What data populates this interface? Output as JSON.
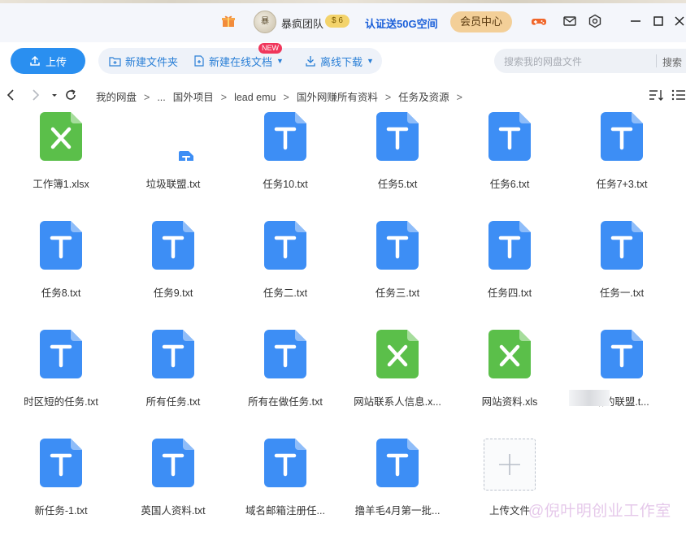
{
  "header": {
    "username": "暴疯团队",
    "coin_badge": "$ 6",
    "promo": "认证送50G空间",
    "vip_button": "会员中心",
    "icons": [
      "gift-icon",
      "game-icon",
      "mail-icon",
      "settings-icon",
      "minimize-icon",
      "maximize-icon",
      "close-icon"
    ]
  },
  "toolbar": {
    "upload": "上传",
    "new_folder": "新建文件夹",
    "new_online_doc": "新建在线文档",
    "new_badge": "NEW",
    "offline_download": "离线下载",
    "search_placeholder": "搜索我的网盘文件",
    "search_button": "搜索"
  },
  "breadcrumb": {
    "items": [
      "我的网盘",
      "...",
      "国外项目",
      "lead emu",
      "国外网赚所有资料",
      "任务及资源"
    ]
  },
  "files": [
    {
      "name": "工作簿1.xlsx",
      "type": "excel"
    },
    {
      "name": "垃圾联盟.txt",
      "type": "txt-small"
    },
    {
      "name": "任务10.txt",
      "type": "txt"
    },
    {
      "name": "任务5.txt",
      "type": "txt"
    },
    {
      "name": "任务6.txt",
      "type": "txt"
    },
    {
      "name": "任务7+3.txt",
      "type": "txt"
    },
    {
      "name": "任务8.txt",
      "type": "txt"
    },
    {
      "name": "任务9.txt",
      "type": "txt"
    },
    {
      "name": "任务二.txt",
      "type": "txt"
    },
    {
      "name": "任务三.txt",
      "type": "txt"
    },
    {
      "name": "任务四.txt",
      "type": "txt"
    },
    {
      "name": "任务一.txt",
      "type": "txt"
    },
    {
      "name": "时区短的任务.txt",
      "type": "txt"
    },
    {
      "name": "所有任务.txt",
      "type": "txt"
    },
    {
      "name": "所有在做任务.txt",
      "type": "txt"
    },
    {
      "name": "网站联系人信息.x...",
      "type": "excel"
    },
    {
      "name": "网站资料.xls",
      "type": "excel"
    },
    {
      "name": "给的联盟.t...",
      "type": "txt"
    },
    {
      "name": "新任务-1.txt",
      "type": "txt"
    },
    {
      "name": "英国人资料.txt",
      "type": "txt"
    },
    {
      "name": "域名邮箱注册任...",
      "type": "txt"
    },
    {
      "name": "撸羊毛4月第一批...",
      "type": "txt"
    }
  ],
  "upload_tile_label": "上传文件",
  "watermark": "@倪叶明创业工作室",
  "colors": {
    "accent": "#2a8ff0",
    "txt_icon": "#3d8ef5",
    "excel_icon": "#5bbf4a",
    "promo_text": "#1a5fd9",
    "vip_button": "#f3cf98"
  }
}
